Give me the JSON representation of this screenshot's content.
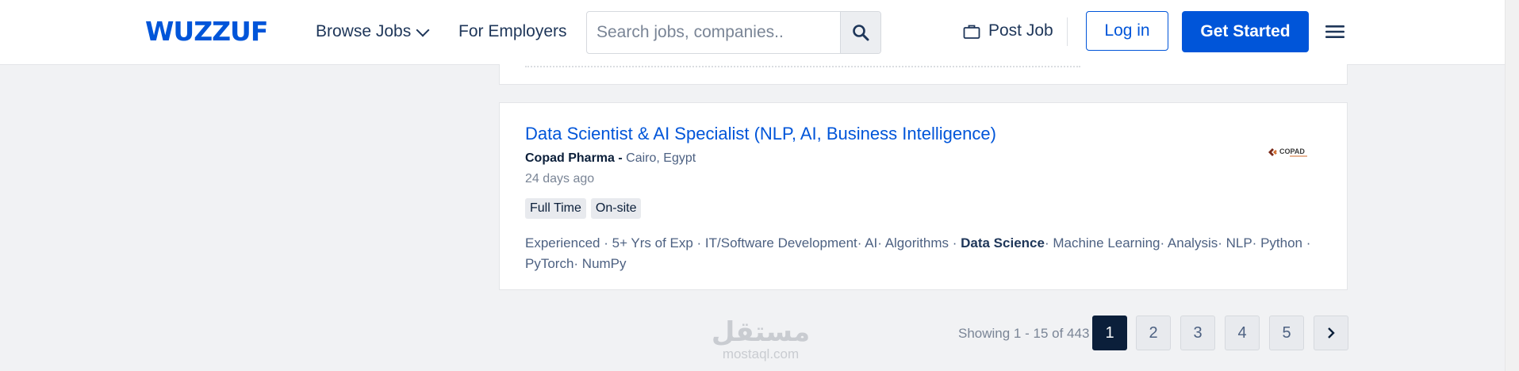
{
  "header": {
    "logo": "WUZZUF",
    "browse_jobs": "Browse Jobs",
    "for_employers": "For Employers",
    "search_placeholder": "Search jobs, companies..",
    "post_job": "Post Job",
    "login": "Log in",
    "get_started": "Get Started"
  },
  "job": {
    "title": "Data Scientist & AI Specialist (NLP, AI, Business Intelligence)",
    "company": "Copad Pharma -",
    "location": "Cairo, Egypt",
    "posted": "24 days ago",
    "tags": [
      "Full Time",
      "On-site"
    ],
    "skills_before": "Experienced · 5+ Yrs of Exp · IT/Software Development· AI· Algorithms · ",
    "skills_highlight": "Data Science",
    "skills_after": "· Machine Learning· Analysis· NLP· Python · PyTorch· NumPy",
    "company_logo_text": "COPAD"
  },
  "pagination": {
    "showing": "Showing 1 - 15 of 443",
    "pages": [
      "1",
      "2",
      "3",
      "4",
      "5"
    ],
    "current_page": "1"
  },
  "watermark": {
    "arabic": "مستقل",
    "latin": "mostaql.com"
  },
  "colors": {
    "brand": "#0055d9",
    "navy": "#0b1f3a",
    "background": "#f1f2f4"
  }
}
